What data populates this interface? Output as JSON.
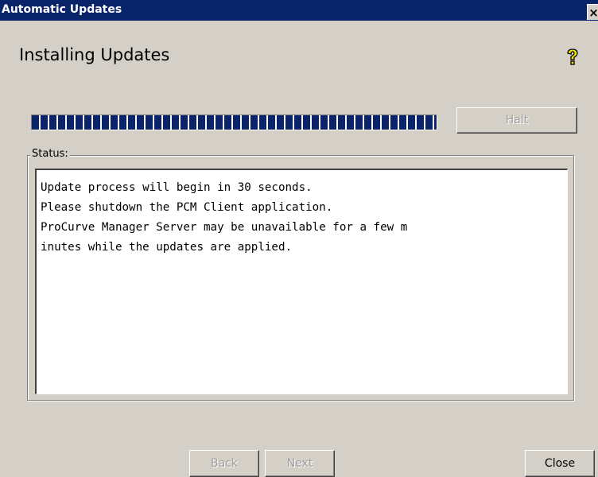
{
  "window": {
    "title": "Automatic Updates",
    "close_glyph": "×"
  },
  "header": {
    "title": "Installing Updates",
    "help_icon": "help-question-icon"
  },
  "progress": {
    "fraction": 1.0
  },
  "buttons": {
    "halt": "Halt",
    "back": "Back",
    "next": "Next",
    "close": "Close"
  },
  "status": {
    "label": "Status:",
    "lines": [
      "Update process will begin in 30 seconds.",
      "Please shutdown the PCM Client application.",
      "ProCurve Manager Server may be unavailable for a few m",
      "inutes while the updates are applied."
    ]
  },
  "colors": {
    "title_bar": "#0a246a",
    "dialog_bg": "#d4d0c8",
    "progress_block": "#0a246a",
    "help_icon": "#f5e000"
  }
}
